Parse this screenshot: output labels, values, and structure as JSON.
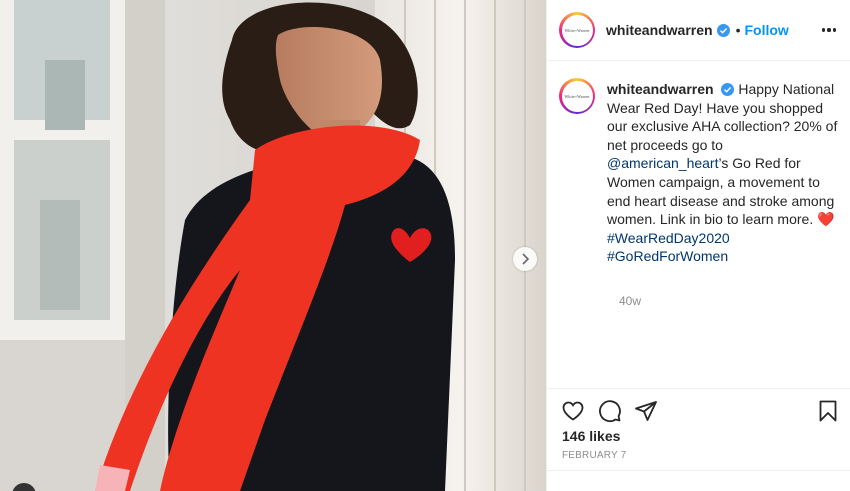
{
  "post": {
    "username": "whiteandwarren",
    "avatar_text": "White+Warren",
    "follow_label": "Follow",
    "bullet": "•",
    "caption_parts": {
      "p1": " Happy National Wear Red Day! Have you shopped our exclusive AHA collection? 20% of net proceeds go to ",
      "mention": "@american_heart",
      "p2": "’s Go Red for Women campaign, a movement to end heart disease and stroke among women. Link in bio to learn more. ",
      "emoji": "❤️",
      "hashtag1": "#WearRedDay2020",
      "hashtag2": "#GoRedForWomen"
    },
    "time_ago": "40w",
    "likes": "146 likes",
    "date": "FEBRUARY 7"
  },
  "colors": {
    "link_blue": "#0095f6",
    "mention_blue": "#00376b",
    "scarf_red": "#ee3322",
    "sweater_black": "#15151c"
  },
  "icons": {
    "verified": "verified-badge-icon",
    "more": "more-options-icon",
    "like": "heart-outline-icon",
    "comment": "comment-icon",
    "share": "paper-plane-icon",
    "save": "bookmark-icon",
    "next": "chevron-right-icon"
  }
}
